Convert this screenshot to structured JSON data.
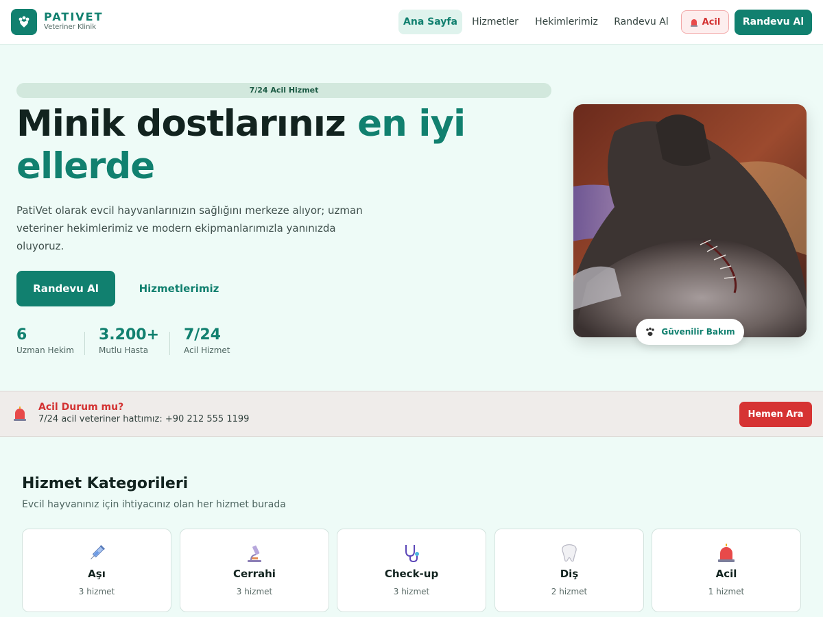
{
  "brand": {
    "name": "PATIVET",
    "tagline": "Veteriner Klinik",
    "color": "#11806f"
  },
  "nav": {
    "items": [
      {
        "label": "Ana Sayfa",
        "active": true
      },
      {
        "label": "Hizmetler",
        "active": false
      },
      {
        "label": "Hekimlerimiz",
        "active": false
      },
      {
        "label": "Randevu Al",
        "active": false
      }
    ],
    "emergency_label": "Acil",
    "cta_label": "Randevu Al"
  },
  "hero": {
    "badge": "7/24 Acil Hizmet",
    "title_main": "Minik dostlarınız ",
    "title_accent": "en iyi ellerde",
    "description": "PatiVet olarak evcil hayvanlarınızın sağlığını merkeze alıyor; uzman veteriner hekimlerimiz ve modern ekipmanlarımızla yanınızda oluyoruz.",
    "primary_button": "Randevu Al",
    "secondary_button": "Hizmetlerimiz",
    "stats": [
      {
        "value": "6",
        "label": "Uzman Hekim"
      },
      {
        "value": "3.200+",
        "label": "Mutlu Hasta"
      },
      {
        "value": "7/24",
        "label": "Acil Hizmet"
      }
    ],
    "image_chip": "Güvenilir Bakım"
  },
  "emergency": {
    "title": "Acil Durum mu?",
    "text": "7/24 acil veteriner hattımız: +90 212 555 1199",
    "button": "Hemen Ara",
    "color": "#d63333"
  },
  "services": {
    "title": "Hizmet Kategorileri",
    "subtitle": "Evcil hayvanınız için ihtiyacınız olan her hizmet burada",
    "categories": [
      {
        "name": "Aşı",
        "count": "3 hizmet",
        "icon": "syringe-icon"
      },
      {
        "name": "Cerrahi",
        "count": "3 hizmet",
        "icon": "microscope-icon"
      },
      {
        "name": "Check-up",
        "count": "3 hizmet",
        "icon": "stethoscope-icon"
      },
      {
        "name": "Diş",
        "count": "2 hizmet",
        "icon": "tooth-icon"
      },
      {
        "name": "Acil",
        "count": "1 hizmet",
        "icon": "siren-icon"
      }
    ]
  }
}
